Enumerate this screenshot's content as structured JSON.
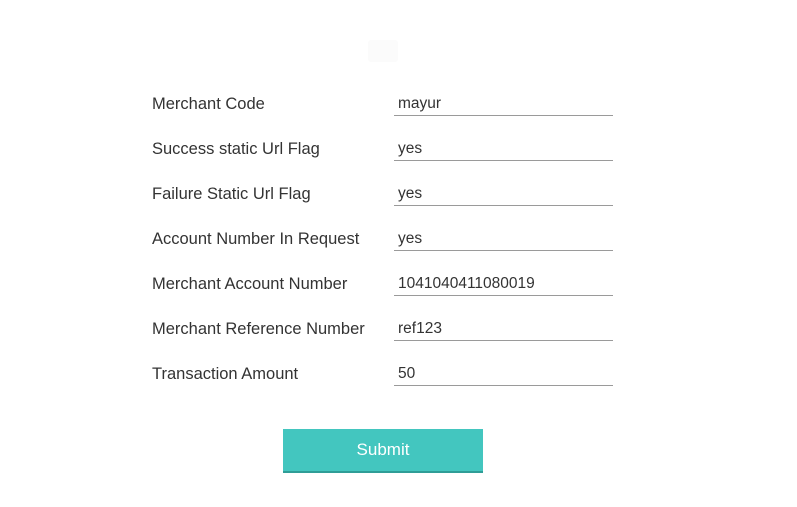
{
  "form": {
    "rows": [
      {
        "label": "Merchant Code",
        "value": "mayur"
      },
      {
        "label": "Success static Url Flag",
        "value": "yes"
      },
      {
        "label": "Failure Static Url Flag",
        "value": "yes"
      },
      {
        "label": "Account Number In Request",
        "value": "yes"
      },
      {
        "label": "Merchant Account Number",
        "value": "1041040411080019"
      },
      {
        "label": "Merchant Reference Number",
        "value": "ref123"
      },
      {
        "label": "Transaction Amount",
        "value": "50"
      }
    ],
    "submit_label": "Submit"
  },
  "colors": {
    "accent": "#43c6bf",
    "text": "#333333",
    "underline": "#9a9a9a"
  }
}
